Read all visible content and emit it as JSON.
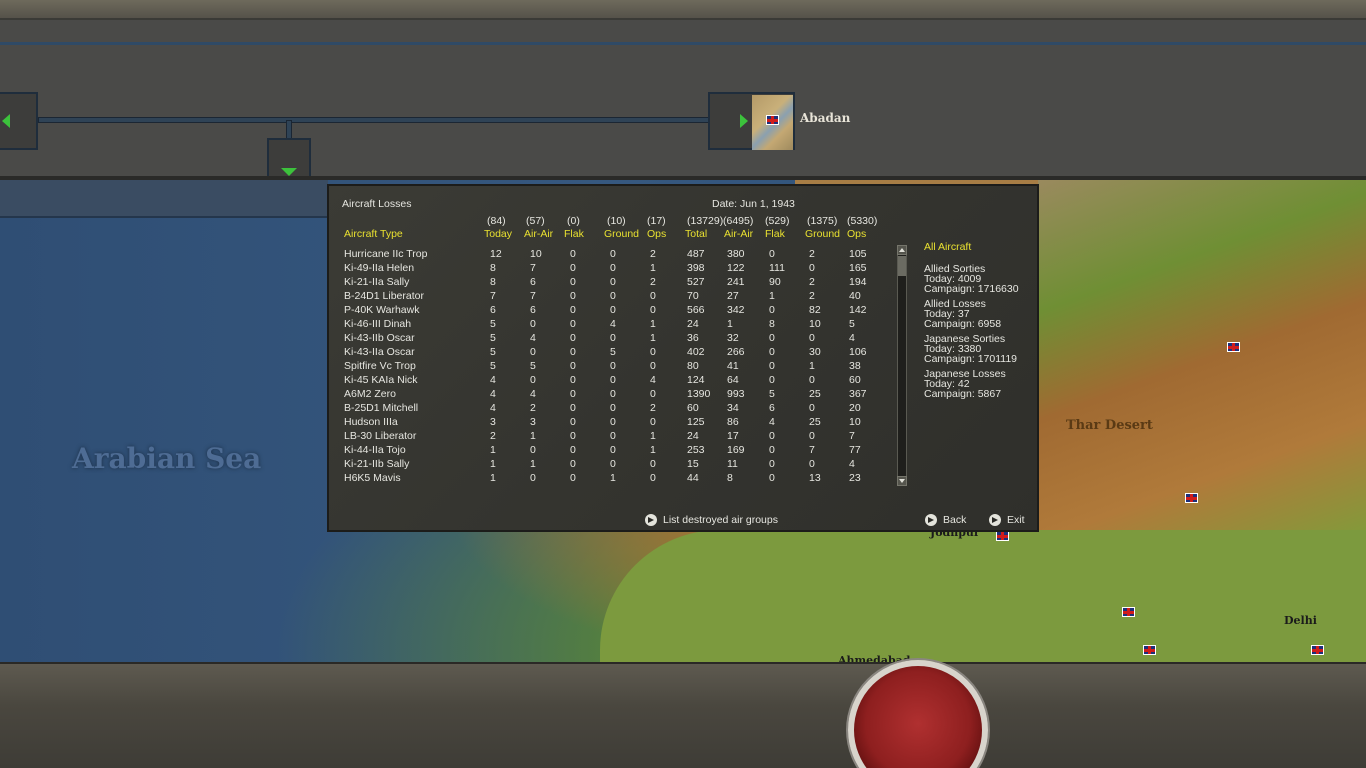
{
  "nav": {
    "node_label": "Abadan"
  },
  "map": {
    "sea_label": "Arabian Sea",
    "desert_label": "Thar Desert",
    "cities": {
      "jodhpur": "Jodhpur",
      "delhi": "Delhi",
      "ahmedabad": "Ahmedabad"
    }
  },
  "dialog": {
    "title": "Aircraft Losses",
    "date": "Date: Jun 1, 1943",
    "header_totals": [
      "(84)",
      "(57)",
      "(0)",
      "(10)",
      "(17)",
      "(13729)",
      "(6495)",
      "(529)",
      "(1375)",
      "(5330)"
    ],
    "header_labels": [
      "Aircraft Type",
      "Today",
      "Air-Air",
      "Flak",
      "Ground",
      "Ops",
      "Total",
      "Air-Air",
      "Flak",
      "Ground",
      "Ops"
    ],
    "rows": [
      [
        "Hurricane IIc Trop",
        "12",
        "10",
        "0",
        "0",
        "2",
        "487",
        "380",
        "0",
        "2",
        "105"
      ],
      [
        "Ki-49-IIa Helen",
        "8",
        "7",
        "0",
        "0",
        "1",
        "398",
        "122",
        "111",
        "0",
        "165"
      ],
      [
        "Ki-21-IIa Sally",
        "8",
        "6",
        "0",
        "0",
        "2",
        "527",
        "241",
        "90",
        "2",
        "194"
      ],
      [
        "B-24D1 Liberator",
        "7",
        "7",
        "0",
        "0",
        "0",
        "70",
        "27",
        "1",
        "2",
        "40"
      ],
      [
        "P-40K Warhawk",
        "6",
        "6",
        "0",
        "0",
        "0",
        "566",
        "342",
        "0",
        "82",
        "142"
      ],
      [
        "Ki-46-III Dinah",
        "5",
        "0",
        "0",
        "4",
        "1",
        "24",
        "1",
        "8",
        "10",
        "5"
      ],
      [
        "Ki-43-IIb Oscar",
        "5",
        "4",
        "0",
        "0",
        "1",
        "36",
        "32",
        "0",
        "0",
        "4"
      ],
      [
        "Ki-43-IIa Oscar",
        "5",
        "0",
        "0",
        "5",
        "0",
        "402",
        "266",
        "0",
        "30",
        "106"
      ],
      [
        "Spitfire Vc Trop",
        "5",
        "5",
        "0",
        "0",
        "0",
        "80",
        "41",
        "0",
        "1",
        "38"
      ],
      [
        "Ki-45 KAIa Nick",
        "4",
        "0",
        "0",
        "0",
        "4",
        "124",
        "64",
        "0",
        "0",
        "60"
      ],
      [
        "A6M2 Zero",
        "4",
        "4",
        "0",
        "0",
        "0",
        "1390",
        "993",
        "5",
        "25",
        "367"
      ],
      [
        "B-25D1 Mitchell",
        "4",
        "2",
        "0",
        "0",
        "2",
        "60",
        "34",
        "6",
        "0",
        "20"
      ],
      [
        "Hudson IIIa",
        "3",
        "3",
        "0",
        "0",
        "0",
        "125",
        "86",
        "4",
        "25",
        "10"
      ],
      [
        "LB-30 Liberator",
        "2",
        "1",
        "0",
        "0",
        "1",
        "24",
        "17",
        "0",
        "0",
        "7"
      ],
      [
        "Ki-44-IIa Tojo",
        "1",
        "0",
        "0",
        "0",
        "1",
        "253",
        "169",
        "0",
        "7",
        "77"
      ],
      [
        "Ki-21-IIb Sally",
        "1",
        "1",
        "0",
        "0",
        "0",
        "15",
        "11",
        "0",
        "0",
        "4"
      ],
      [
        "H6K5 Mavis",
        "1",
        "0",
        "0",
        "1",
        "0",
        "44",
        "8",
        "0",
        "13",
        "23"
      ]
    ],
    "side": {
      "filter": "All Aircraft",
      "allied_sorties_title": "Allied Sorties",
      "allied_sorties_today": "Today:   4009",
      "allied_sorties_campaign": "Campaign: 1716630",
      "allied_losses_title": "Allied Losses",
      "allied_losses_today": "Today:   37",
      "allied_losses_campaign": "Campaign: 6958",
      "japanese_sorties_title": "Japanese Sorties",
      "japanese_sorties_today": "Today:   3380",
      "japanese_sorties_campaign": "Campaign: 1701119",
      "japanese_losses_title": "Japanese Losses",
      "japanese_losses_today": "Today:   42",
      "japanese_losses_campaign": "Campaign: 5867"
    },
    "buttons": {
      "list_destroyed": "List destroyed air groups",
      "back": "Back",
      "exit": "Exit"
    }
  }
}
